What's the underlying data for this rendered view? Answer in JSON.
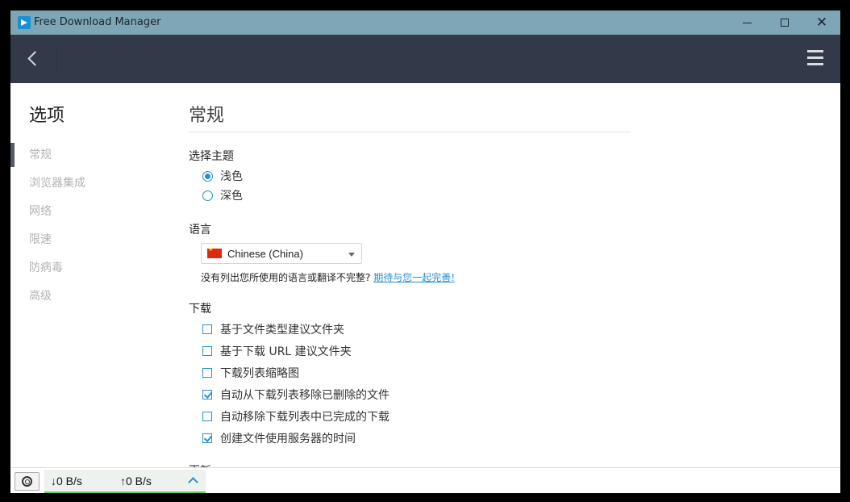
{
  "window": {
    "title": "Free Download Manager"
  },
  "sidebar": {
    "title": "选项",
    "items": [
      {
        "label": "常规"
      },
      {
        "label": "浏览器集成"
      },
      {
        "label": "网络"
      },
      {
        "label": "限速"
      },
      {
        "label": "防病毒"
      },
      {
        "label": "高级"
      }
    ]
  },
  "main": {
    "section_title": "常规",
    "theme": {
      "label": "选择主题",
      "options": [
        {
          "label": "浅色",
          "selected": true
        },
        {
          "label": "深色",
          "selected": false
        }
      ]
    },
    "language": {
      "label": "语言",
      "selected": "Chinese (China)",
      "note": "没有列出您所使用的语言或翻译不完整?",
      "link": "期待与您一起完善!"
    },
    "download": {
      "label": "下载",
      "options": [
        {
          "label": "基于文件类型建议文件夹",
          "checked": false
        },
        {
          "label": "基于下载 URL 建议文件夹",
          "checked": false
        },
        {
          "label": "下载列表缩略图",
          "checked": false
        },
        {
          "label": "自动从下载列表移除已删除的文件",
          "checked": true
        },
        {
          "label": "自动移除下载列表中已完成的下载",
          "checked": false
        },
        {
          "label": "创建文件使用服务器的时间",
          "checked": true
        }
      ]
    },
    "next_section_label": "更新"
  },
  "statusbar": {
    "download_speed": "↓0 B/s",
    "upload_speed": "↑0 B/s"
  },
  "colors": {
    "titlebar": "#7fa6b6",
    "toolbar": "#323a49",
    "accent": "#2b8fd0",
    "speed_bar": "#6cc46c"
  }
}
